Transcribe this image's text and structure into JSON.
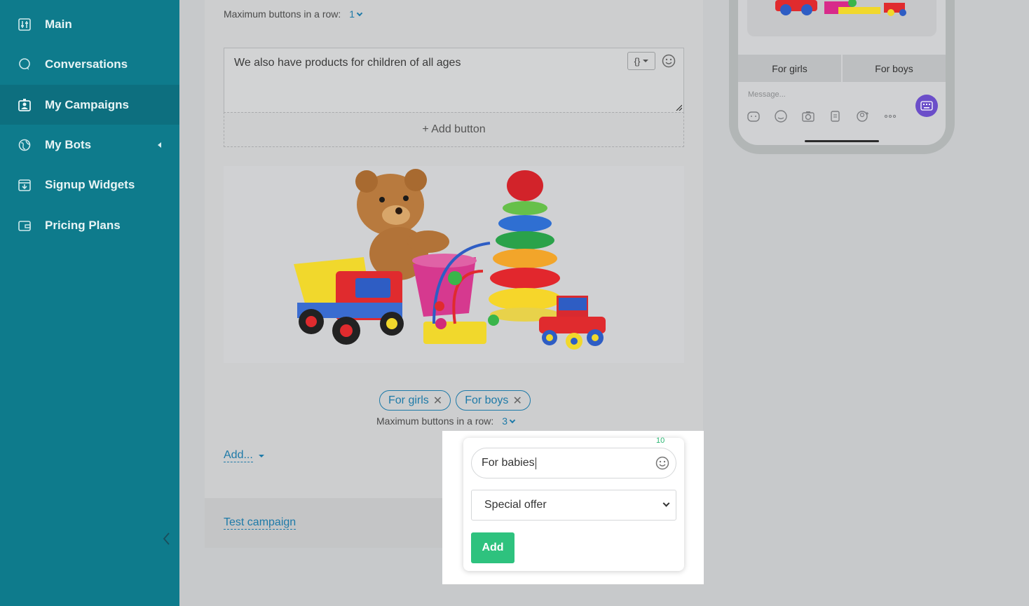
{
  "sidebar": {
    "items": [
      {
        "label": "Main",
        "icon": "sliders-icon"
      },
      {
        "label": "Conversations",
        "icon": "chat-bubble-icon"
      },
      {
        "label": "My Campaigns",
        "icon": "campaign-icon",
        "active": true
      },
      {
        "label": "My Bots",
        "icon": "bot-icon",
        "has_submenu": true
      },
      {
        "label": "Signup Widgets",
        "icon": "widget-icon"
      },
      {
        "label": "Pricing Plans",
        "icon": "wallet-icon"
      }
    ]
  },
  "editor": {
    "max_buttons_label": "Maximum buttons in a row:",
    "max_buttons_value_1": "1",
    "message_text": "We also have products for children of all ages",
    "add_button_label": "+ Add button",
    "buttons": [
      "For girls",
      "For boys"
    ],
    "max_buttons_value_2": "3",
    "add_menu_label": "Add...",
    "test_campaign_label": "Test campaign"
  },
  "preview": {
    "quick_buttons": [
      "For girls",
      "For boys"
    ],
    "message_placeholder": "Message..."
  },
  "popover": {
    "char_counter": "10",
    "button_text": "For babies",
    "action_select": "Special offer",
    "add_label": "Add"
  },
  "colors": {
    "sidebar_bg": "#0e7b8c",
    "accent_blue": "#1e7aa8",
    "add_green": "#2ec27e",
    "keyboard_purple": "#6b4ec9"
  }
}
